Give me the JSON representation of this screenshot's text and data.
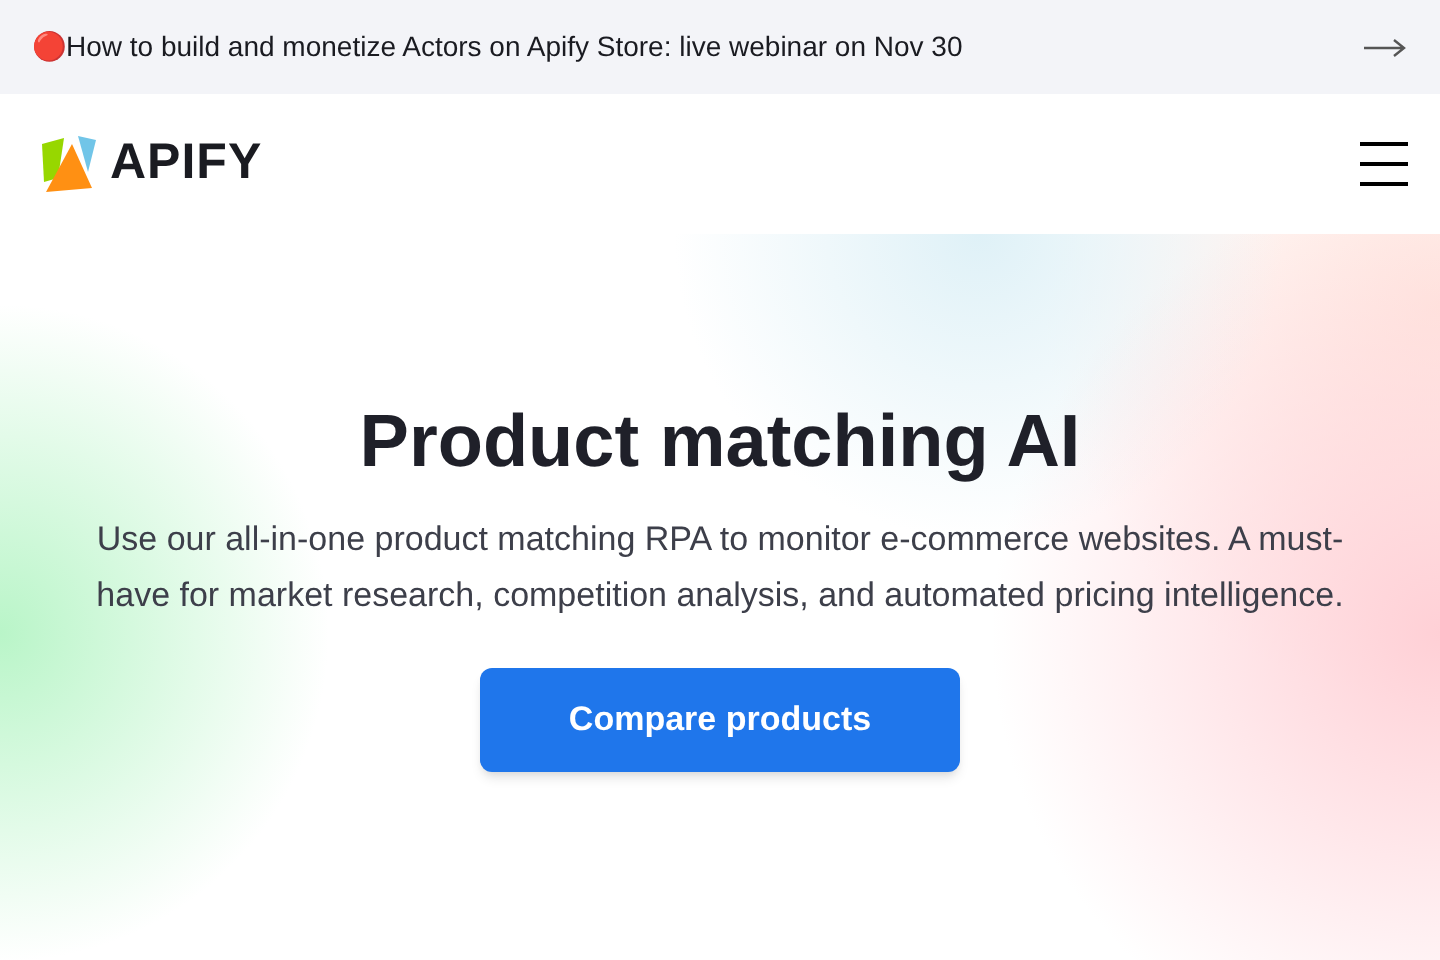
{
  "announcement": {
    "text": "🔴How to build and monetize Actors on Apify Store: live webinar on Nov 30"
  },
  "header": {
    "logo_text": "APIFY"
  },
  "hero": {
    "title": "Product matching AI",
    "description": "Use our all-in-one product matching RPA to monitor e-commerce websites. A must-have for market research, competition analysis, and automated pricing intelligence.",
    "button": "Compare products"
  }
}
